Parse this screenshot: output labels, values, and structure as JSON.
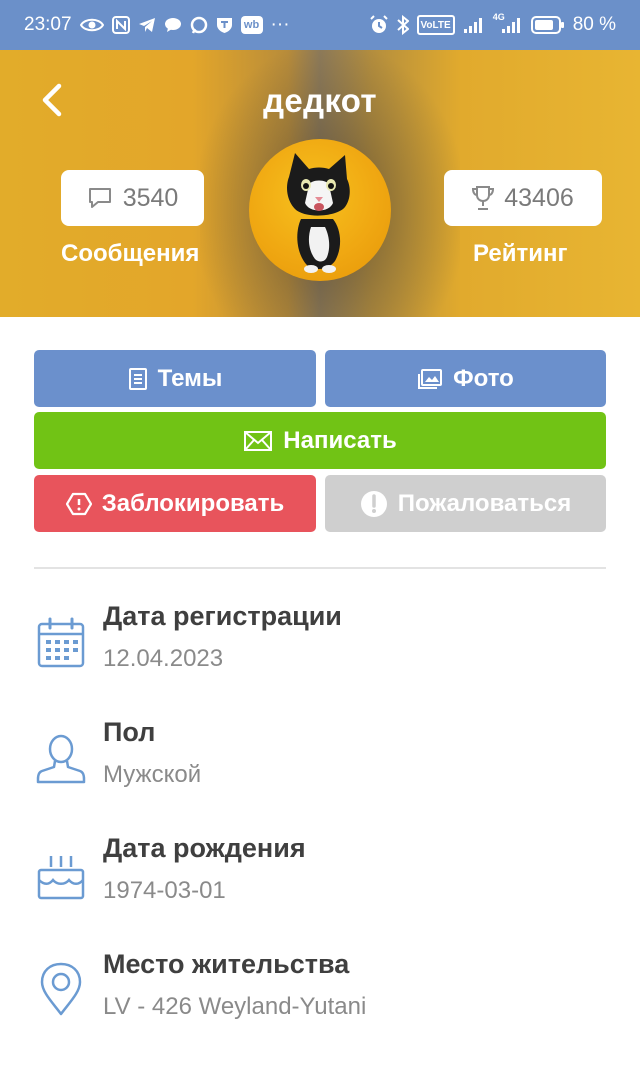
{
  "status_bar": {
    "time": "23:07",
    "more": "···",
    "battery_percent": "80 %",
    "icons_left": [
      "eye-icon",
      "nfc-icon",
      "telegram-icon",
      "chat-bubble-icon",
      "messenger-icon",
      "shield-icon",
      "wb-icon"
    ],
    "wb_label": "wb",
    "icons_right": [
      "alarm-icon",
      "bluetooth-icon",
      "volte-icon",
      "signal-icon",
      "signal-4g-icon",
      "battery-icon"
    ],
    "volte_label": "VoLTE",
    "net_label": "4G"
  },
  "profile": {
    "name": "дедкот",
    "messages_count": "3540",
    "messages_label": "Сообщения",
    "rating_count": "43406",
    "rating_label": "Рейтинг"
  },
  "actions": {
    "topics": "Темы",
    "photo": "Фото",
    "write": "Написать",
    "block": "Заблокировать",
    "report": "Пожаловаться"
  },
  "info": {
    "registration": {
      "title": "Дата регистрации",
      "value": "12.04.2023"
    },
    "gender": {
      "title": "Пол",
      "value": "Мужской"
    },
    "birth": {
      "title": "Дата рождения",
      "value": "1974-03-01"
    },
    "residence": {
      "title": "Место жительства",
      "value": "LV - 426 Weyland-Yutani"
    }
  },
  "colors": {
    "status_bar": "#6b90c9",
    "header": "#e3a62a",
    "primary_button": "#6b90cc",
    "write_button": "#71c315",
    "block_button": "#e8545c",
    "report_button": "#cfcfcf",
    "info_icon": "#6b9bd2"
  }
}
